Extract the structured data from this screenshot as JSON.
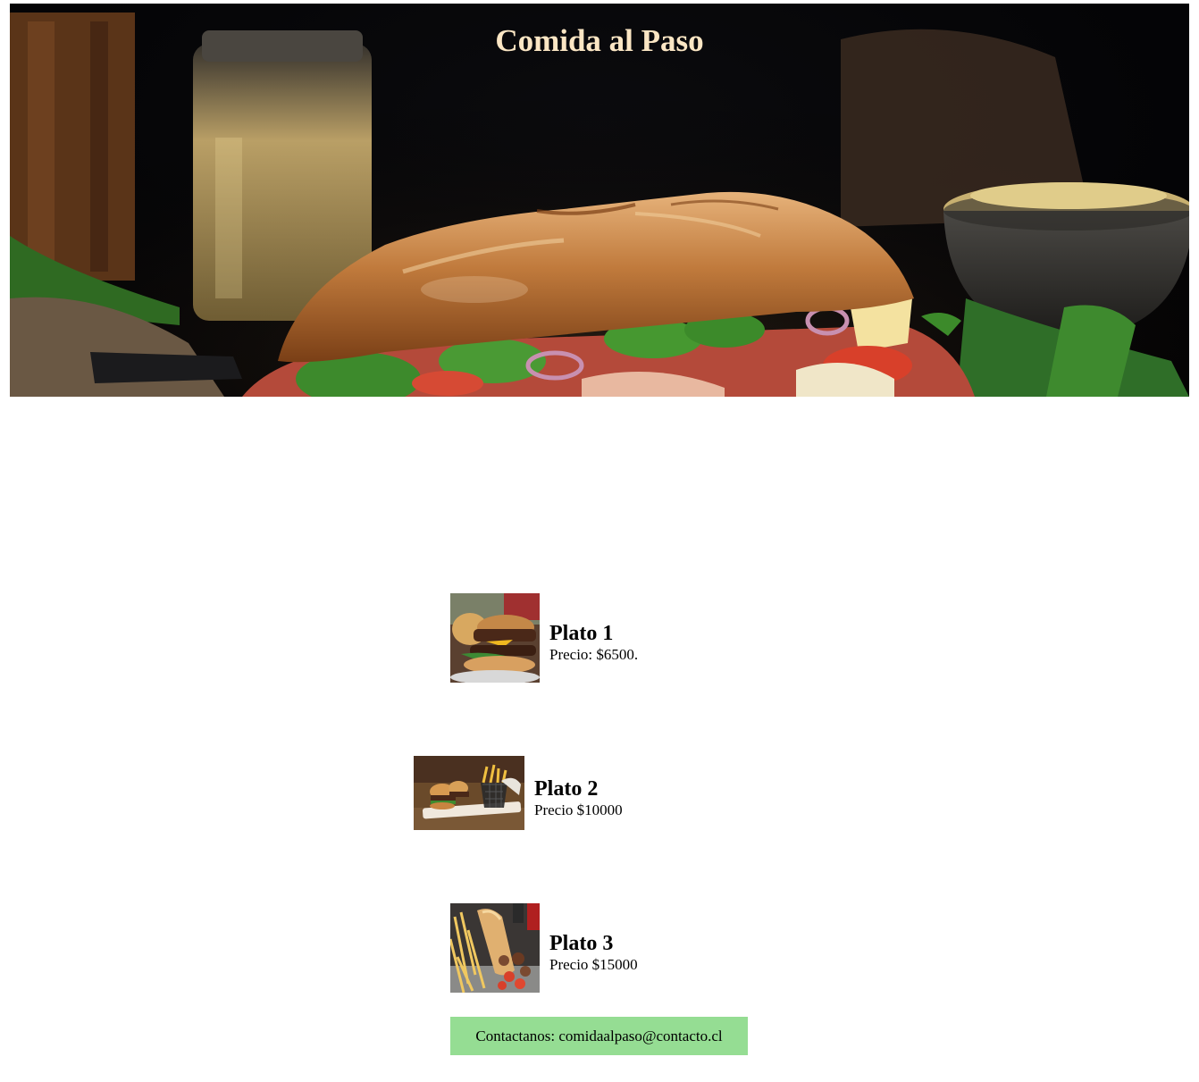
{
  "hero": {
    "title": "Comida al Paso",
    "image": "sandwich-baguette-photo"
  },
  "menu": {
    "items": [
      {
        "name": "Plato 1",
        "price": "Precio: $6500.",
        "image": "burger-photo"
      },
      {
        "name": "Plato 2",
        "price": "Precio $10000",
        "image": "burgers-and-fries-photo"
      },
      {
        "name": "Plato 3",
        "price": "Precio $15000",
        "image": "sandwich-and-fries-photo"
      }
    ]
  },
  "footer": {
    "contact": "Contactanos: comidaalpaso@contacto.cl"
  },
  "colors": {
    "title": "#fbe6c4",
    "contact_bg": "#95dd93"
  }
}
